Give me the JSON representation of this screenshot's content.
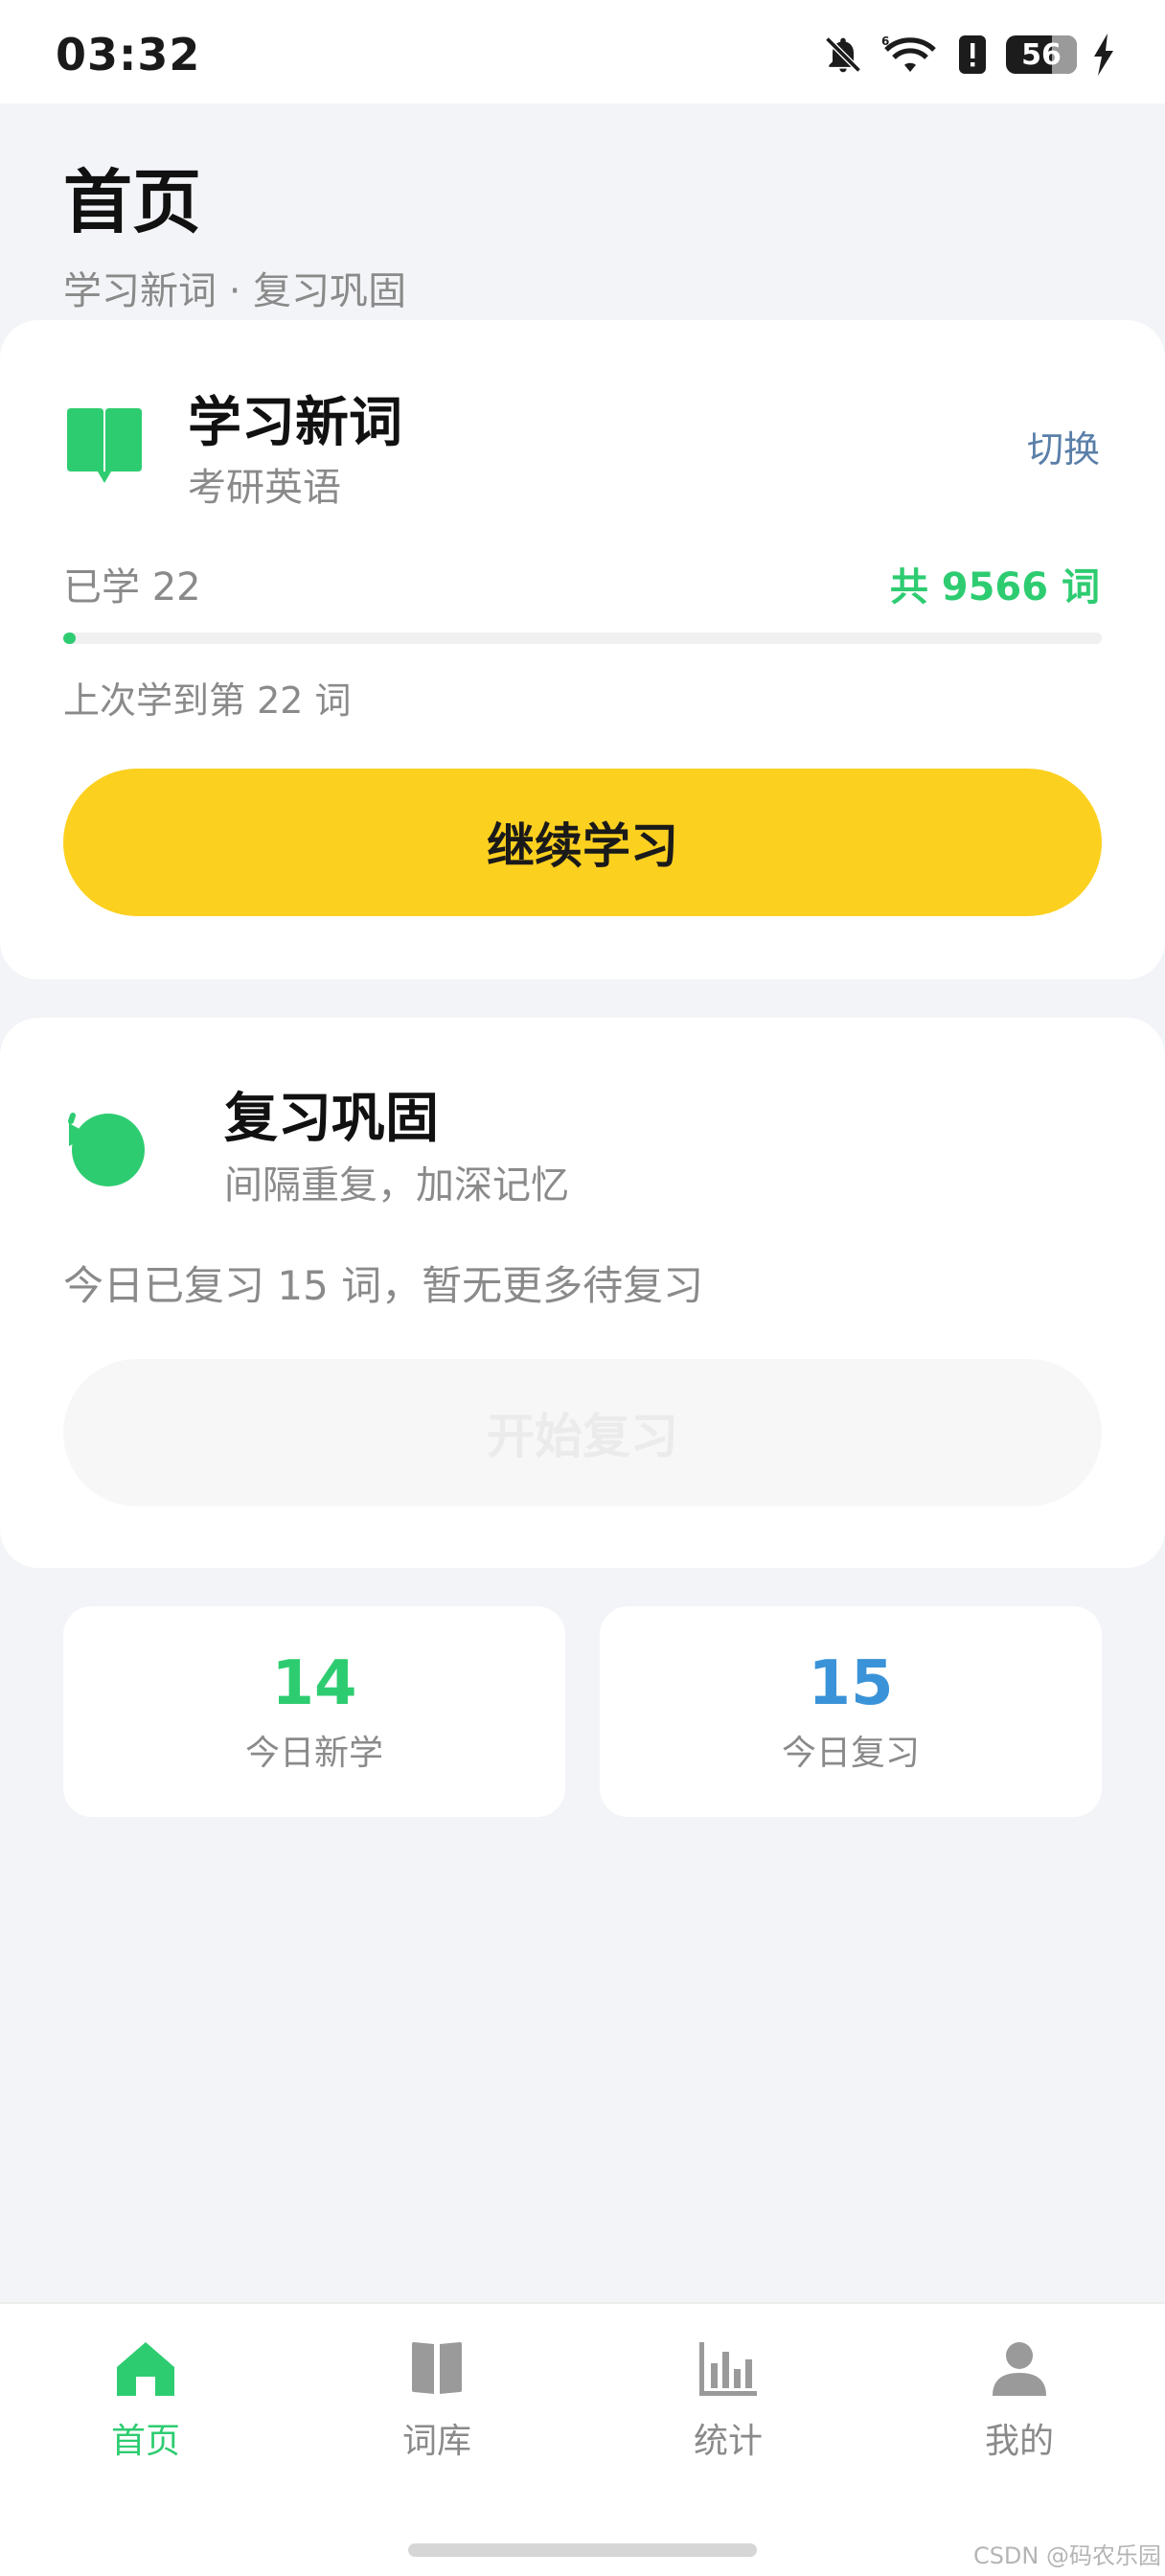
{
  "status_bar": {
    "time": "03:32",
    "battery_level": "56",
    "icons": [
      "bell-off-icon",
      "wifi-icon",
      "alert-icon",
      "battery-icon",
      "charging-icon"
    ]
  },
  "header": {
    "title": "首页",
    "subtitle": "学习新词 · 复习巩固"
  },
  "learn_card": {
    "title": "学习新词",
    "subtitle": "考研英语",
    "switch_label": "切换",
    "learned_label": "已学 22",
    "total_label": "共 9566 词",
    "progress_fraction": 0.0023,
    "last_position": "上次学到第 22 词",
    "continue_label": "继续学习",
    "accent_color": "#2ecc71",
    "button_color": "#fcd01f"
  },
  "review_card": {
    "title": "复习巩固",
    "subtitle": "间隔重复，加深记忆",
    "status_text": "今日已复习 15 词，暂无更多待复习",
    "start_label": "开始复习",
    "start_enabled": false
  },
  "stats": {
    "new_today": "14",
    "new_today_label": "今日新学",
    "new_today_color": "#2ecc71",
    "review_today": "15",
    "review_today_label": "今日复习",
    "review_today_color": "#3a93d8"
  },
  "tabbar": {
    "tabs": [
      {
        "label": "首页",
        "icon": "home-icon",
        "active": true
      },
      {
        "label": "词库",
        "icon": "book-icon",
        "active": false
      },
      {
        "label": "统计",
        "icon": "bar-chart-icon",
        "active": false
      },
      {
        "label": "我的",
        "icon": "person-icon",
        "active": false
      }
    ]
  },
  "watermark": "CSDN @码农乐园"
}
